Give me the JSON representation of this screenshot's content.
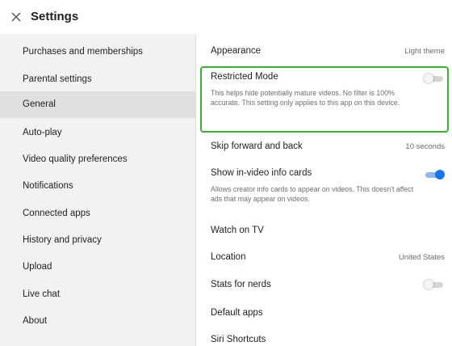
{
  "header": {
    "title": "Settings",
    "close_icon": "close-icon"
  },
  "sidebar": {
    "items": [
      {
        "label": "Purchases and memberships"
      },
      {
        "label": "Parental settings"
      },
      {
        "label": "General",
        "active": true
      },
      {
        "label": "Auto-play"
      },
      {
        "label": "Video quality preferences"
      },
      {
        "label": "Notifications"
      },
      {
        "label": "Connected apps"
      },
      {
        "label": "History and privacy"
      },
      {
        "label": "Upload"
      },
      {
        "label": "Live chat"
      },
      {
        "label": "About"
      }
    ]
  },
  "settings": {
    "appearance": {
      "label": "Appearance",
      "value": "Light theme"
    },
    "restricted_mode": {
      "label": "Restricted Mode",
      "description": "This helps hide potentially mature videos. No filter is 100% accurate. This setting only applies to this app on this device.",
      "enabled": false
    },
    "skip": {
      "label": "Skip forward and back",
      "value": "10 seconds"
    },
    "info_cards": {
      "label": "Show in-video info cards",
      "description": "Allows creator info cards to appear on videos. This doesn't affect ads that may appear on videos.",
      "enabled": true
    },
    "watch_tv": {
      "label": "Watch on TV"
    },
    "location": {
      "label": "Location",
      "value": "United States"
    },
    "stats": {
      "label": "Stats for nerds",
      "enabled": false
    },
    "default_apps": {
      "label": "Default apps"
    },
    "siri": {
      "label": "Siri Shortcuts"
    }
  },
  "colors": {
    "highlight": "#3cb033",
    "toggle_on": "#1a73e8",
    "sidebar_bg": "#f2f2f2",
    "sidebar_active": "#e0e0e0"
  }
}
